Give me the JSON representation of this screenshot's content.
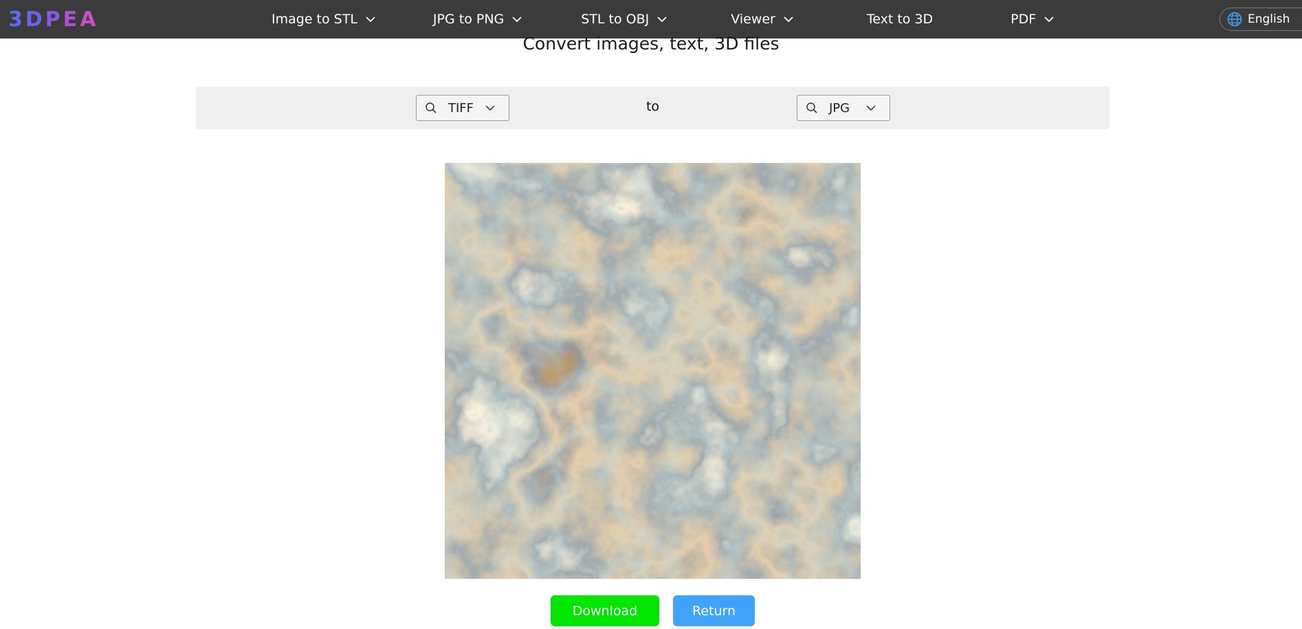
{
  "logo": {
    "letters": [
      "3",
      "D",
      "P",
      "E",
      "A"
    ],
    "colors": [
      "#5b6cf5",
      "#6b63ee",
      "#8c57e2",
      "#b04fd4",
      "#c94fc9"
    ]
  },
  "nav": {
    "items": [
      {
        "label": "Image to STL",
        "has_dropdown": true
      },
      {
        "label": "JPG to PNG",
        "has_dropdown": true
      },
      {
        "label": "STL to OBJ",
        "has_dropdown": true
      },
      {
        "label": "Viewer",
        "has_dropdown": true
      },
      {
        "label": "Text to 3D",
        "has_dropdown": false
      },
      {
        "label": "PDF",
        "has_dropdown": true
      }
    ],
    "language": "English"
  },
  "header": {
    "subtitle": "Convert images, text, 3D files"
  },
  "converter": {
    "from_format": "TIFF",
    "to_label": "to",
    "to_format": "JPG"
  },
  "actions": {
    "download_label": "Download",
    "download_color": "#00e600",
    "return_label": "Return",
    "return_color": "#3fa2fb"
  },
  "icons": {
    "search": "search-icon",
    "chevron": "chevron-down-icon",
    "globe": "globe-icon"
  }
}
